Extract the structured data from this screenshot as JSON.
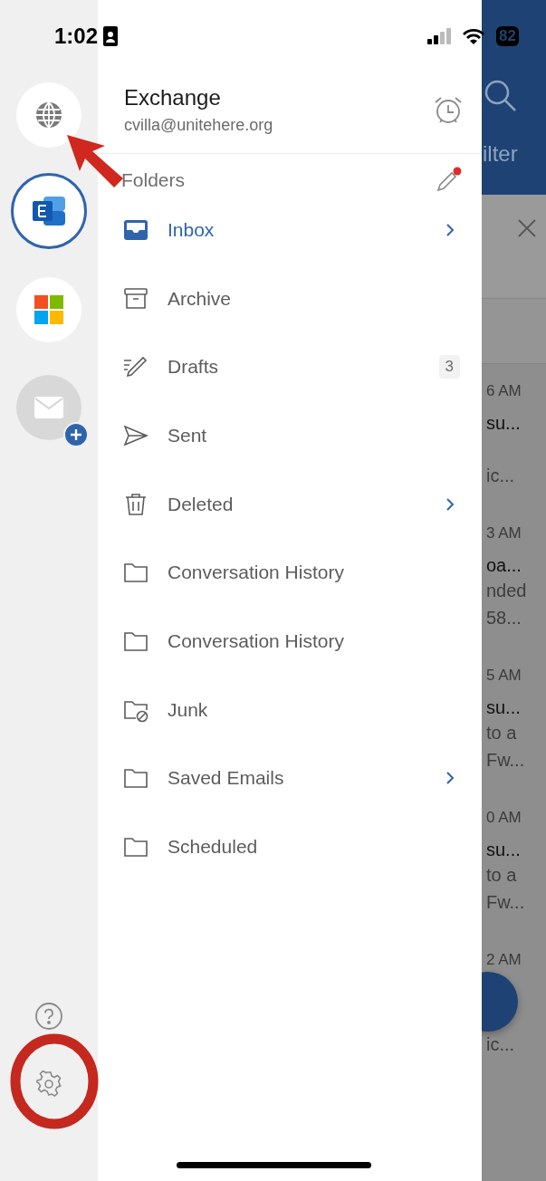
{
  "status_bar": {
    "time": "1:02",
    "battery": "82"
  },
  "accounts": [
    {
      "kind": "globe",
      "selected": false
    },
    {
      "kind": "exchange",
      "selected": true
    },
    {
      "kind": "microsoft",
      "selected": false
    },
    {
      "kind": "add-mail",
      "selected": false
    }
  ],
  "account": {
    "name": "Exchange",
    "email": "cvilla@unitehere.org"
  },
  "folders_heading": "Folders",
  "folders": [
    {
      "kind": "inbox",
      "label": "Inbox",
      "selected": true,
      "expandable": true
    },
    {
      "kind": "archive",
      "label": "Archive",
      "selected": false,
      "expandable": false
    },
    {
      "kind": "drafts",
      "label": "Drafts",
      "selected": false,
      "expandable": false,
      "count": "3"
    },
    {
      "kind": "sent",
      "label": "Sent",
      "selected": false,
      "expandable": false
    },
    {
      "kind": "deleted",
      "label": "Deleted",
      "selected": false,
      "expandable": true
    },
    {
      "kind": "folder",
      "label": "Conversation History",
      "selected": false,
      "expandable": false
    },
    {
      "kind": "folder",
      "label": "Conversation History",
      "selected": false,
      "expandable": false
    },
    {
      "kind": "junk",
      "label": "Junk",
      "selected": false,
      "expandable": false
    },
    {
      "kind": "folder",
      "label": "Saved Emails",
      "selected": false,
      "expandable": true
    },
    {
      "kind": "folder",
      "label": "Scheduled",
      "selected": false,
      "expandable": false
    }
  ],
  "mail_list": {
    "filter_label": "ilter",
    "emails": [
      {
        "time": "6 AM",
        "subject": "su...",
        "preview": [
          "ic..."
        ]
      },
      {
        "time": "3 AM",
        "subject": "oa...",
        "preview": [
          "nded",
          "58..."
        ]
      },
      {
        "time": "5 AM",
        "subject": "su...",
        "preview": [
          "to a",
          "Fw..."
        ]
      },
      {
        "time": "0 AM",
        "subject": "su...",
        "preview": [
          "to a",
          "Fw..."
        ]
      },
      {
        "time": "2 AM",
        "preview": [
          "ic..."
        ]
      }
    ]
  }
}
